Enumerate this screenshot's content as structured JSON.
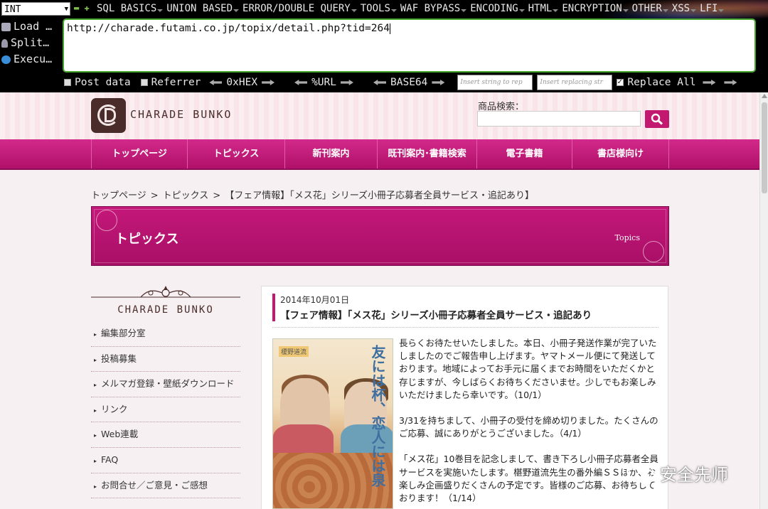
{
  "hackbar": {
    "select_value": "INT",
    "menu": [
      "SQL BASICS",
      "UNION BASED",
      "ERROR/DOUBLE QUERY",
      "TOOLS",
      "WAF BYPASS",
      "ENCODING",
      "HTML",
      "ENCRYPTION",
      "OTHER",
      "XSS",
      "LFI"
    ],
    "side": [
      "Load …",
      "Split…",
      "Execu…"
    ],
    "url_value": "http://charade.futami.co.jp/topix/detail.php?tid=264",
    "post_data_label": "Post data",
    "referrer_label": "Referrer",
    "hex_label": "0xHEX",
    "url_label": "%URL",
    "base64_label": "BASE64",
    "insert_placeholder": "Insert string to rep",
    "replace_placeholder": "Insert replacing str",
    "replace_all_label": "Replace All",
    "replace_all_checked": true
  },
  "site": {
    "logo_text": "CHARADE BUNKO",
    "search_label": "商品検索：",
    "nav": [
      "トップページ",
      "トピックス",
      "新刊案内",
      "既刊案内･書籍検索",
      "電子書籍",
      "書店様向け"
    ],
    "breadcrumb": [
      "トップページ",
      "トピックス",
      "【フェア情報】「メス花」シリーズ小冊子応募者全員サービス・追記あり】"
    ],
    "topics_title": "トピックス",
    "topics_en": "Topics",
    "sidebar_logo": "CHARADE BUNKO",
    "sidebar_items": [
      "編集部分室",
      "投稿募集",
      "メルマガ登録・壁紙ダウンロード",
      "リンク",
      "Web連載",
      "FAQ",
      "お問合せ／ご意見・ご感想"
    ]
  },
  "article": {
    "date": "2014年10月01日",
    "title": "【フェア情報】「メス花」シリーズ小冊子応募者全員サービス・追記あり",
    "cover_title": "友には杯、恋人には泉",
    "cover_author": "榎野道流",
    "paragraphs": [
      "長らくお待たせいたしました。本日、小冊子発送作業が完了いたしましたのでご報告申し上げます。ヤマトメール便にて発送しております。地域によってお手元に届くまでお時間をいただくかと存じますが、今しばらくお待ちくださいませ。少しでもお楽しみいただけましたら幸いです。（10/1）",
      "3/31を持ちまして、小冊子の受付を締め切りました。たくさんのご応募、誠にありがとうございました。（4/1）",
      "「メス花」10巻目を記念しまして、書き下ろし小冊子応募者全員サービスを実施いたします。椹野道流先生の番外編ＳＳほか、お楽しみ企画盛りだくさんの予定です。皆様のご応募、お待ちしております！（1/14）"
    ]
  },
  "watermark": {
    "text": "安全先师"
  }
}
